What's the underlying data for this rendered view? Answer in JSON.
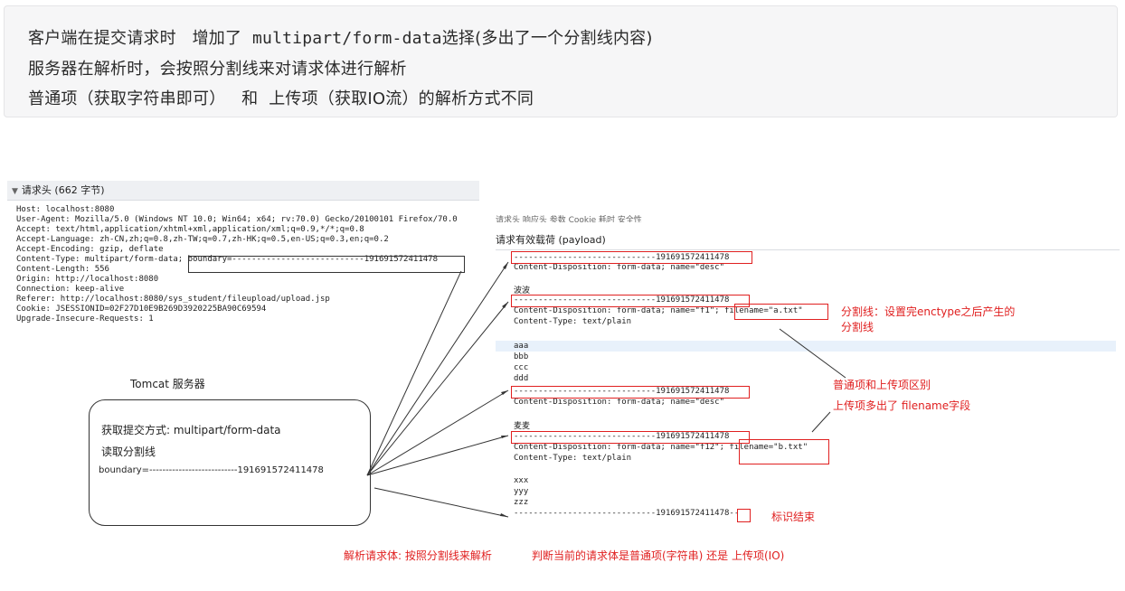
{
  "note": {
    "line1_a": "客户端在提交请求时   增加了  ",
    "line1_b": "multipart/form-data",
    "line1_c": "选择(多出了一个分割线内容)",
    "line2": "服务器在解析时，会按照分割线来对请求体进行解析",
    "line3": "普通项（获取字符串即可）   和  上传项（获取IO流）的解析方式不同"
  },
  "headers_panel": {
    "title": "请求头 (662 字节)",
    "lines": [
      "Host: localhost:8080",
      "User-Agent: Mozilla/5.0 (Windows NT 10.0; Win64; x64; rv:70.0) Gecko/20100101 Firefox/70.0",
      "Accept: text/html,application/xhtml+xml,application/xml;q=0.9,*/*;q=0.8",
      "Accept-Language: zh-CN,zh;q=0.8,zh-TW;q=0.7,zh-HK;q=0.5,en-US;q=0.3,en;q=0.2",
      "Accept-Encoding: gzip, deflate",
      "Content-Type: multipart/form-data; boundary=---------------------------191691572411478",
      "Content-Length: 556",
      "Origin: http://localhost:8080",
      "Connection: keep-alive",
      "Referer: http://localhost:8080/sys_student/fileupload/upload.jsp",
      "Cookie: JSESSIONID=02F27D10E9B269D3920225BA90C69594",
      "Upgrade-Insecure-Requests: 1"
    ]
  },
  "payload_panel": {
    "top_strip": "请求头   响应头   参数   Cookie   耗时   安全性",
    "title": "请求有效载荷 (payload)",
    "lines": [
      "-----------------------------191691572411478",
      "Content-Disposition: form-data; name=\"desc\"",
      "",
      "波波",
      "-----------------------------191691572411478",
      "Content-Disposition: form-data; name=\"f1\"; filename=\"a.txt\"",
      "Content-Type: text/plain",
      "",
      "aaa",
      "bbb",
      "ccc",
      "ddd",
      "-----------------------------191691572411478",
      "Content-Disposition: form-data; name=\"desc\"",
      "",
      "麦麦",
      "-----------------------------191691572411478",
      "Content-Disposition: form-data; name=\"f12\"; filename=\"b.txt\"",
      "Content-Type: text/plain",
      "",
      "xxx",
      "yyy",
      "zzz",
      "-----------------------------191691572411478--"
    ]
  },
  "server": {
    "title": "Tomcat  服务器",
    "line1": "获取提交方式: multipart/form-data",
    "line2": "读取分割线",
    "line3": "boundary=---------------------------191691572411478"
  },
  "annotations": {
    "divider_a": "分割线：设置完enctype之后产生的",
    "divider_b": "分割线",
    "diff": "普通项和上传项区别",
    "filename": "上传项多出了 filename字段",
    "end": "标识结束",
    "parse_body": "解析请求体:  按照分割线来解析",
    "judge": "判断当前的请求体是普通项(字符串) 还是 上传项(IO)"
  },
  "colors": {
    "annotation": "#e02020",
    "note_bg": "#f6f6f7"
  }
}
